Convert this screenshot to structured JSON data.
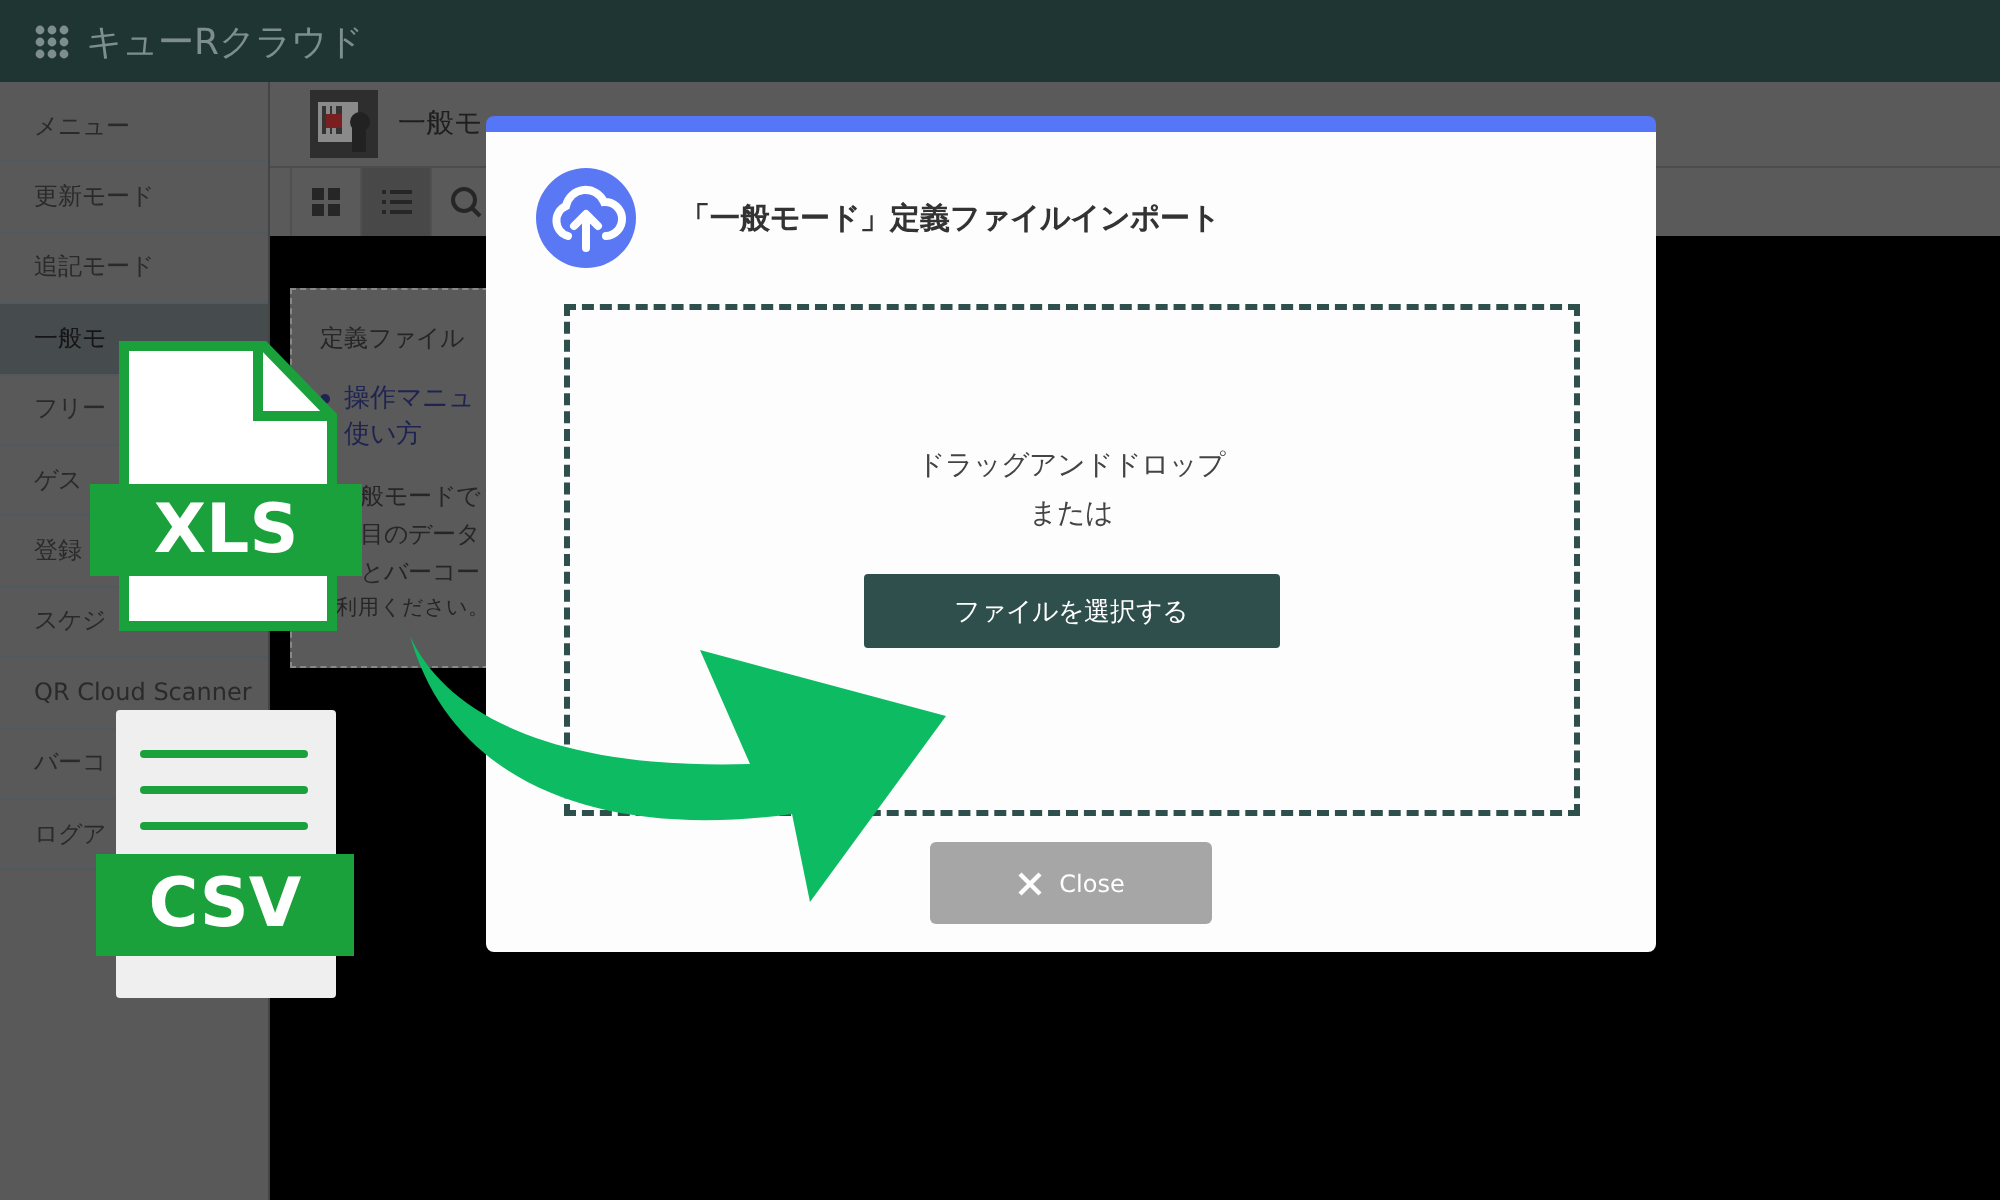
{
  "app_header": {
    "title": "キューRクラウド"
  },
  "sidebar": {
    "items": [
      {
        "label": "メニュー",
        "selected": false
      },
      {
        "label": "更新モード",
        "selected": false
      },
      {
        "label": "追記モード",
        "selected": false
      },
      {
        "label": "一般モ",
        "selected": true
      },
      {
        "label": "フリー",
        "selected": false
      },
      {
        "label": "ゲス",
        "selected": false
      },
      {
        "label": "登録",
        "selected": false
      },
      {
        "label": "スケジ",
        "selected": false
      },
      {
        "label": "QR Cloud Scanner",
        "selected": false
      },
      {
        "label": "バーコ",
        "selected": false
      },
      {
        "label": "ログア",
        "selected": false
      }
    ]
  },
  "page": {
    "title": "一般モ",
    "toolbar": [
      {
        "kind": "grid",
        "selected": false
      },
      {
        "kind": "list",
        "selected": true
      },
      {
        "kind": "search",
        "selected": false
      }
    ],
    "card": {
      "heading": "定義ファイル",
      "links": [
        "操作マニュ",
        "使い方"
      ],
      "lines": [
        "般モードで",
        "目のデータ",
        "とバーコー",
        "利用ください。"
      ]
    }
  },
  "dialog": {
    "title": "「一般モード」定義ファイルインポート",
    "drop_text": "ドラッグアンドドロップ",
    "drop_subtext": "または",
    "select_button": "ファイルを選択する",
    "close_button": "Close"
  },
  "file_badges": [
    {
      "kind": "xls",
      "label": "XLS"
    },
    {
      "kind": "csv",
      "label": "CSV"
    }
  ]
}
